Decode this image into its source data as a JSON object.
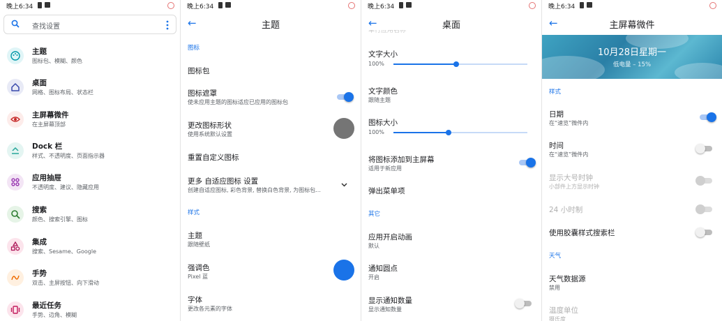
{
  "status": {
    "time": "晚上6:34"
  },
  "settings_home": {
    "search_placeholder": "查找设置",
    "items": [
      {
        "title": "主题",
        "subtitle": "图标包、模糊、颜色",
        "icon": "palette-icon",
        "color": "#0097a7",
        "bg": "#e0f5f7"
      },
      {
        "title": "桌面",
        "subtitle": "网格、图标布局、状态栏",
        "icon": "home-icon",
        "color": "#3949ab",
        "bg": "#e8eaf6"
      },
      {
        "title": "主屏幕微件",
        "subtitle": "在主屏幕顶部",
        "icon": "eye-icon",
        "color": "#c62828",
        "bg": "#fdecea"
      },
      {
        "title": "Dock 栏",
        "subtitle": "样式、不透明度、页面指示器",
        "icon": "dock-icon",
        "color": "#26a69a",
        "bg": "#e4f5f2"
      },
      {
        "title": "应用抽屉",
        "subtitle": "不透明度、建议、隐藏应用",
        "icon": "apps-icon",
        "color": "#8e24aa",
        "bg": "#f3e5f5"
      },
      {
        "title": "搜索",
        "subtitle": "颜色、搜索引擎、图标",
        "icon": "search-icon",
        "color": "#2e7d32",
        "bg": "#e6f4e7"
      },
      {
        "title": "集成",
        "subtitle": "搜索、Sesame、Google",
        "icon": "shapes-icon",
        "color": "#ad1457",
        "bg": "#fce4ec"
      },
      {
        "title": "手势",
        "subtitle": "双击、主屏按钮、向下滑动",
        "icon": "gesture-icon",
        "color": "#ef6c00",
        "bg": "#fff0e0"
      },
      {
        "title": "最近任务",
        "subtitle": "手势、边角、模糊",
        "icon": "recents-icon",
        "color": "#c2185b",
        "bg": "#fce4ec"
      }
    ]
  },
  "theme": {
    "title": "主题",
    "section_icons": "图标",
    "icon_pack": "图标包",
    "icon_mask": {
      "title": "图标遮罩",
      "subtitle": "使未应用主题的图标适应已应用的图标包",
      "on": true
    },
    "icon_shape": {
      "title": "更改图标形状",
      "subtitle": "使用系统默认设置",
      "swatch": "#757575"
    },
    "reset_icons": "重置自定义图标",
    "more_adaptive": {
      "title": "更多 自适应图标 设置",
      "subtitle": "创建自适应图标, 彩色背景, 替换白色背景, 为图标包..."
    },
    "section_style": "样式",
    "theme_item": {
      "title": "主题",
      "subtitle": "跟随壁纸"
    },
    "accent": {
      "title": "强调色",
      "subtitle": "Pixel 蓝",
      "swatch": "#1a73e8"
    },
    "font": {
      "title": "字体",
      "subtitle": "更改各元素的字体"
    }
  },
  "desktop": {
    "title": "桌面",
    "clipped_header": "单行应用名称",
    "text_size": {
      "title": "文字大小",
      "value": "100%",
      "level": 0.47
    },
    "text_color": {
      "title": "文字颜色",
      "subtitle": "跟随主题"
    },
    "icon_size": {
      "title": "图标大小",
      "value": "100%",
      "level": 0.41
    },
    "add_icons": {
      "title": "将图标添加到主屏幕",
      "subtitle": "适用于新应用",
      "on": true
    },
    "popup_menu": "弹出菜单项",
    "section_other": "其它",
    "app_anim": {
      "title": "应用开启动画",
      "subtitle": "默认"
    },
    "notif_dots": {
      "title": "通知圆点",
      "subtitle": "开启"
    },
    "notif_count": {
      "title": "显示通知数量",
      "subtitle": "显示通知数量",
      "on": false
    }
  },
  "widget": {
    "title": "主屏幕微件",
    "preview_date": "10月28日星期一",
    "preview_batt": "低电量 – 15%",
    "section_style": "样式",
    "date": {
      "title": "日期",
      "subtitle": "在“速览”微件内",
      "on": true
    },
    "time": {
      "title": "时间",
      "subtitle": "在“速览”微件内",
      "on": false
    },
    "large_clock": {
      "title": "显示大号时钟",
      "subtitle": "小部件上方显示时钟",
      "on": false
    },
    "clock24": {
      "title": "24 小时制",
      "on": false
    },
    "pill_search": {
      "title": "使用胶囊样式搜索栏",
      "on": false
    },
    "section_weather": "天气",
    "weather_src": {
      "title": "天气数据源",
      "subtitle": "禁用"
    },
    "temp_unit": {
      "title": "温度单位",
      "subtitle": "摄氏度"
    }
  }
}
